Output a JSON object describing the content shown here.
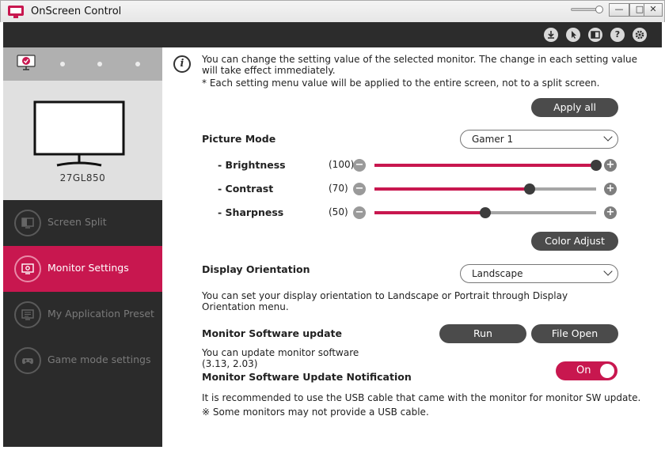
{
  "window": {
    "title": "OnScreen Control",
    "minimize": "—",
    "maximize": "□",
    "close": "✕"
  },
  "sidebar": {
    "monitor_model": "27GL850",
    "items": [
      {
        "label": "Screen Split"
      },
      {
        "label": "Monitor Settings"
      },
      {
        "label": "My Application Preset"
      },
      {
        "label": "Game mode settings"
      }
    ]
  },
  "info": {
    "text": "You can change the setting value of the selected monitor. The change in each setting value will take effect immediately.",
    "note": "* Each setting menu value will be applied to the entire screen, not to a split screen."
  },
  "apply_all": "Apply all",
  "picture_mode": {
    "label": "Picture Mode",
    "selected": "Gamer 1",
    "sliders": [
      {
        "label": "- Brightness",
        "display": "(100)",
        "value": 100
      },
      {
        "label": "- Contrast",
        "display": "(70)",
        "value": 70
      },
      {
        "label": "- Sharpness",
        "display": "(50)",
        "value": 50
      }
    ]
  },
  "minus": "−",
  "plus": "+",
  "color_adjust": "Color Adjust",
  "orientation": {
    "label": "Display Orientation",
    "selected": "Landscape",
    "desc": "You can set your display orientation to Landscape or Portrait through Display Orientation menu."
  },
  "software_update": {
    "label": "Monitor Software update",
    "run": "Run",
    "file_open": "File Open",
    "desc": "You can update monitor software",
    "version": "(3.13, 2.03)"
  },
  "notification": {
    "label": "Monitor Software Update Notification",
    "toggle": "On",
    "desc1": "It is recommended to use the USB cable that came with the monitor for monitor SW update.",
    "desc2": "※ Some monitors may not provide a USB cable."
  },
  "colors": {
    "accent": "#c8174f",
    "dark": "#2b2b2b",
    "button": "#4b4b4b"
  }
}
